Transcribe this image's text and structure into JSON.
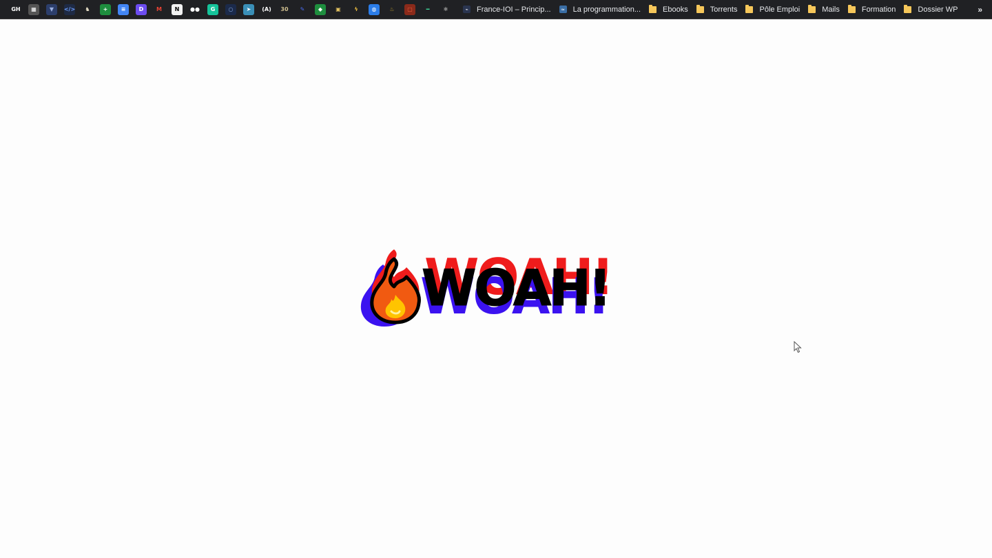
{
  "bookmarks_bar": {
    "icons": [
      {
        "name": "gh-icon",
        "glyph": "GH",
        "bg": "#202124",
        "fg": "#ffffff"
      },
      {
        "name": "page-icon",
        "glyph": "▦",
        "bg": "#555555",
        "fg": "#ffffff"
      },
      {
        "name": "shield-icon",
        "glyph": "▼",
        "bg": "#2c3e6b",
        "fg": "#9bb0e0"
      },
      {
        "name": "code-icon",
        "glyph": "</>",
        "bg": "#1e2a44",
        "fg": "#6fa0ff"
      },
      {
        "name": "deer-icon",
        "glyph": "♞",
        "bg": "#202124",
        "fg": "#e8e0c8"
      },
      {
        "name": "sheets-icon",
        "glyph": "+",
        "bg": "#1e8e3e",
        "fg": "#ffffff"
      },
      {
        "name": "docs-icon",
        "glyph": "≡",
        "bg": "#4285f4",
        "fg": "#ffffff"
      },
      {
        "name": "d-app-icon",
        "glyph": "D",
        "bg": "#6c4cf0",
        "fg": "#ffffff"
      },
      {
        "name": "gmail-icon",
        "glyph": "M",
        "bg": "#202124",
        "fg": "#ea4335"
      },
      {
        "name": "notion-icon",
        "glyph": "N",
        "bg": "#f1f1f1",
        "fg": "#000000"
      },
      {
        "name": "medium-icon",
        "glyph": "●●",
        "bg": "#202124",
        "fg": "#ffffff"
      },
      {
        "name": "grammarly-icon",
        "glyph": "G",
        "bg": "#15c39a",
        "fg": "#ffffff"
      },
      {
        "name": "circle-icon",
        "glyph": "○",
        "bg": "#1b2a4a",
        "fg": "#7ea1d8"
      },
      {
        "name": "send-icon",
        "glyph": "➤",
        "bg": "#3a8fb7",
        "fg": "#ffffff"
      },
      {
        "name": "a11y-icon",
        "glyph": "(A)",
        "bg": "#202124",
        "fg": "#ffffff"
      },
      {
        "name": "30-icon",
        "glyph": "30",
        "bg": "#202124",
        "fg": "#d0c090"
      },
      {
        "name": "pen-icon",
        "glyph": "✎",
        "bg": "#202124",
        "fg": "#4a6cf0"
      },
      {
        "name": "leaf-icon",
        "glyph": "◆",
        "bg": "#1e8e3e",
        "fg": "#ffffff"
      },
      {
        "name": "box-icon",
        "glyph": "▣",
        "bg": "#202124",
        "fg": "#e0c060"
      },
      {
        "name": "bolt-icon",
        "glyph": "ϟ",
        "bg": "#202124",
        "fg": "#f0c040"
      },
      {
        "name": "globe-icon",
        "glyph": "◍",
        "bg": "#2b7de9",
        "fg": "#ffffff"
      },
      {
        "name": "bulb-icon",
        "glyph": "♨",
        "bg": "#202124",
        "fg": "#c0a030"
      },
      {
        "name": "frame-icon",
        "glyph": "▢",
        "bg": "#8a2a1a",
        "fg": "#f06040"
      },
      {
        "name": "dash-icon",
        "glyph": "━",
        "bg": "#202124",
        "fg": "#40e0a0"
      },
      {
        "name": "gear-icon",
        "glyph": "✱",
        "bg": "#202124",
        "fg": "#888888"
      }
    ],
    "items": [
      {
        "name": "bookmark-france-ioi",
        "label": "France-IOI – Princip...",
        "type": "site",
        "fav": "⌁",
        "fav_bg": "#2a3550"
      },
      {
        "name": "bookmark-la-programmation",
        "label": "La programmation...",
        "type": "site",
        "fav": "≈",
        "fav_bg": "#3a6ea5"
      },
      {
        "name": "bookmark-ebooks",
        "label": "Ebooks",
        "type": "folder"
      },
      {
        "name": "bookmark-torrents",
        "label": "Torrents",
        "type": "folder"
      },
      {
        "name": "bookmark-pole-emploi",
        "label": "Pôle Emploi",
        "type": "folder"
      },
      {
        "name": "bookmark-mails",
        "label": "Mails",
        "type": "folder"
      },
      {
        "name": "bookmark-formation",
        "label": "Formation",
        "type": "folder"
      },
      {
        "name": "bookmark-dossier-wp",
        "label": "Dossier WP",
        "type": "folder"
      }
    ],
    "overflow": "»"
  },
  "hero": {
    "text": "WOAH!",
    "colors": {
      "red": "#ef1c1c",
      "blue": "#3b12f0",
      "black": "#000000",
      "flame_outer": "#f15a11",
      "flame_inner": "#ffc400"
    },
    "icon": "fire-icon"
  }
}
